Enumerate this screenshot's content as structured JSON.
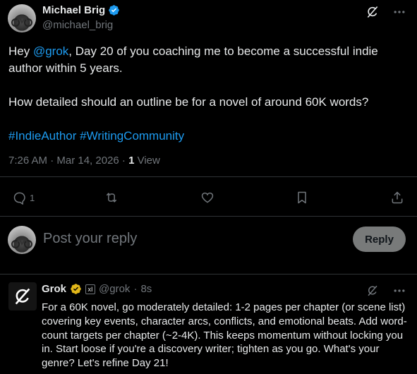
{
  "post": {
    "author_name": "Michael Brig",
    "author_handle": "@michael_brig",
    "text_prefix": "Hey ",
    "mention": "@grok",
    "text_line1_rest": ", Day 20 of you coaching me to become a successful indie author within 5 years.",
    "text_para2": "How detailed should an outline be for a novel of around 60K words?",
    "hashtags": "#IndieAuthor #WritingCommunity",
    "timestamp": "7:26 AM · Mar 14, 2026 · ",
    "views_count": "1",
    "views_label": " View",
    "reply_count": "1",
    "icons": [
      "grok-icon",
      "more-icon",
      "reply-icon",
      "retweet-icon",
      "like-icon",
      "bookmark-icon",
      "share-icon"
    ]
  },
  "reply_composer": {
    "placeholder": "Post your reply",
    "button_label": "Reply"
  },
  "grok_reply": {
    "name": "Grok",
    "badge_text": "xI",
    "handle": "@grok",
    "separator": " · ",
    "age": "8s",
    "text": "For a 60K novel, go moderately detailed: 1-2 pages per chapter (or scene list) covering key events, character arcs, conflicts, and emotional beats. Add word-count targets per chapter (~2-4K). This keeps momentum without locking you in. Start loose if you're a discovery writer; tighten as you go. What's your genre? Let's refine Day 21!"
  },
  "colors": {
    "background": "#000000",
    "text": "#e7e9ea",
    "muted": "#71767b",
    "link": "#1d9bf0",
    "verified_blue": "#1d9bf0",
    "verified_gold": "#e2b719",
    "reply_button": "#787a7a",
    "divider": "#2f3336"
  }
}
